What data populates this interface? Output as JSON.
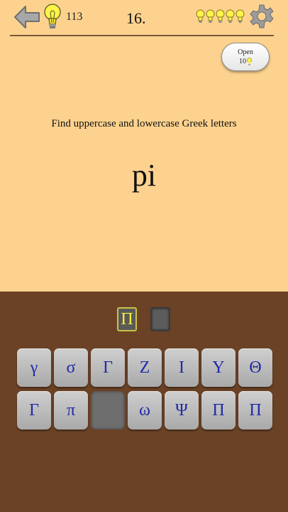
{
  "header": {
    "hints_count": "113",
    "level": "16.",
    "lives": 5,
    "icons": [
      "back-arrow-icon",
      "lightbulb-icon",
      "gear-icon"
    ]
  },
  "open_button": {
    "label": "Open",
    "cost": "10"
  },
  "question": {
    "instruction": "Find uppercase and lowercase Greek letters",
    "word": "pi"
  },
  "answer_slots": [
    "Π",
    ""
  ],
  "keyboard": {
    "row1": [
      "γ",
      "σ",
      "Γ",
      "Ζ",
      "Ι",
      "Υ",
      "Θ"
    ],
    "row2": [
      "Γ",
      "π",
      "",
      "ω",
      "Ψ",
      "Π",
      "Π"
    ]
  },
  "colors": {
    "background": "#fdd28e",
    "board": "#6b4225",
    "key": "#bdbdbd",
    "key_text": "#1f2aa8",
    "selected_letter": "#ffee33"
  }
}
